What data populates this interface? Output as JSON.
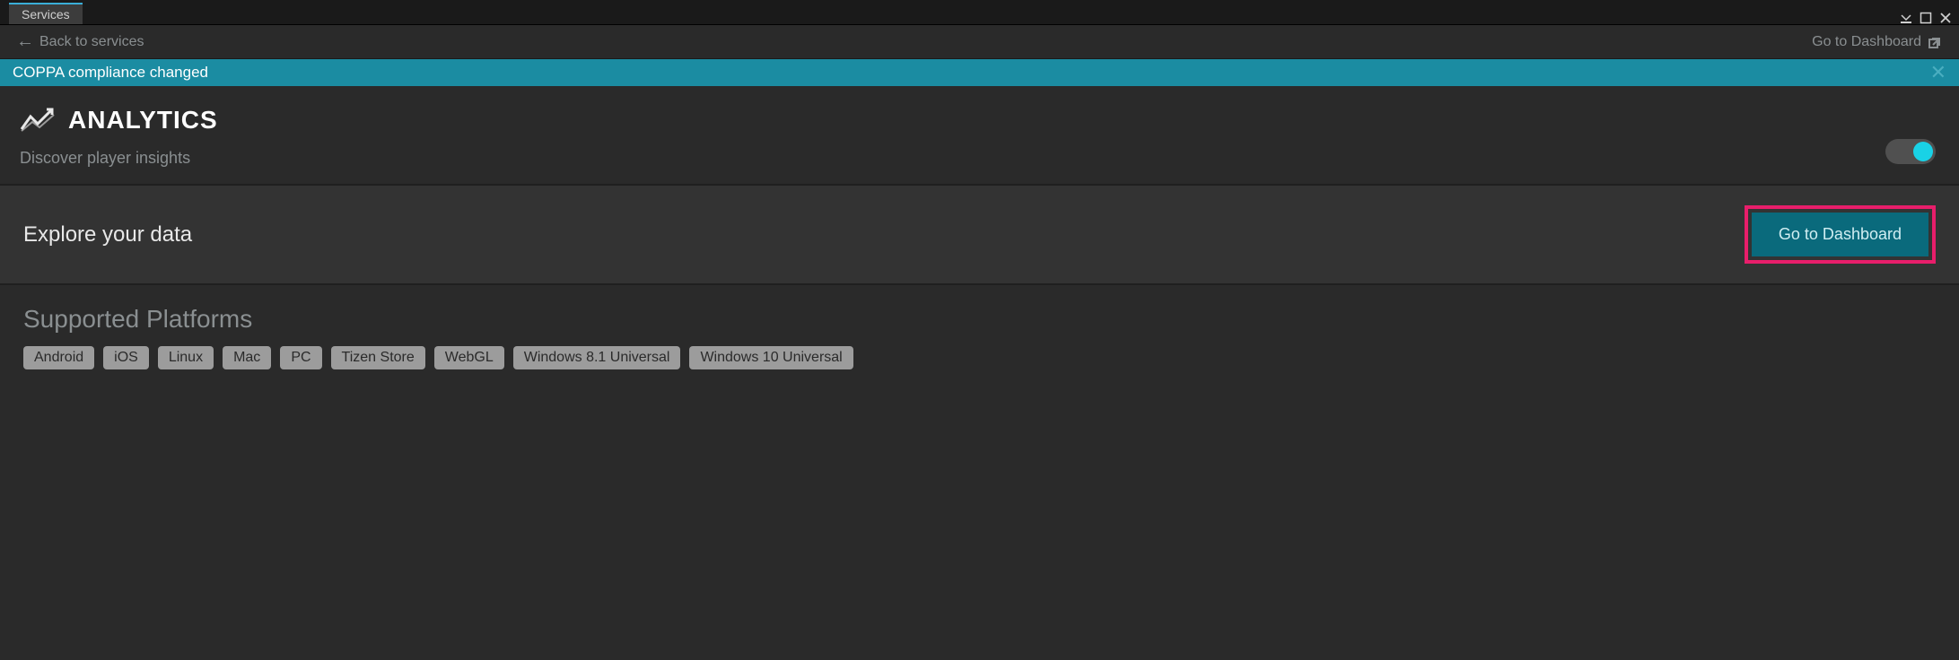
{
  "tab": {
    "title": "Services"
  },
  "nav": {
    "back_label": "Back to services",
    "dashboard_label": "Go to Dashboard"
  },
  "notice": {
    "text": "COPPA compliance changed"
  },
  "header": {
    "title": "ANALYTICS",
    "subtitle": "Discover player insights",
    "toggle_on": true
  },
  "explore": {
    "label": "Explore your data",
    "button": "Go to Dashboard"
  },
  "platforms": {
    "title": "Supported Platforms",
    "items": [
      "Android",
      "iOS",
      "Linux",
      "Mac",
      "PC",
      "Tizen Store",
      "WebGL",
      "Windows 8.1 Universal",
      "Windows 10 Universal"
    ]
  }
}
